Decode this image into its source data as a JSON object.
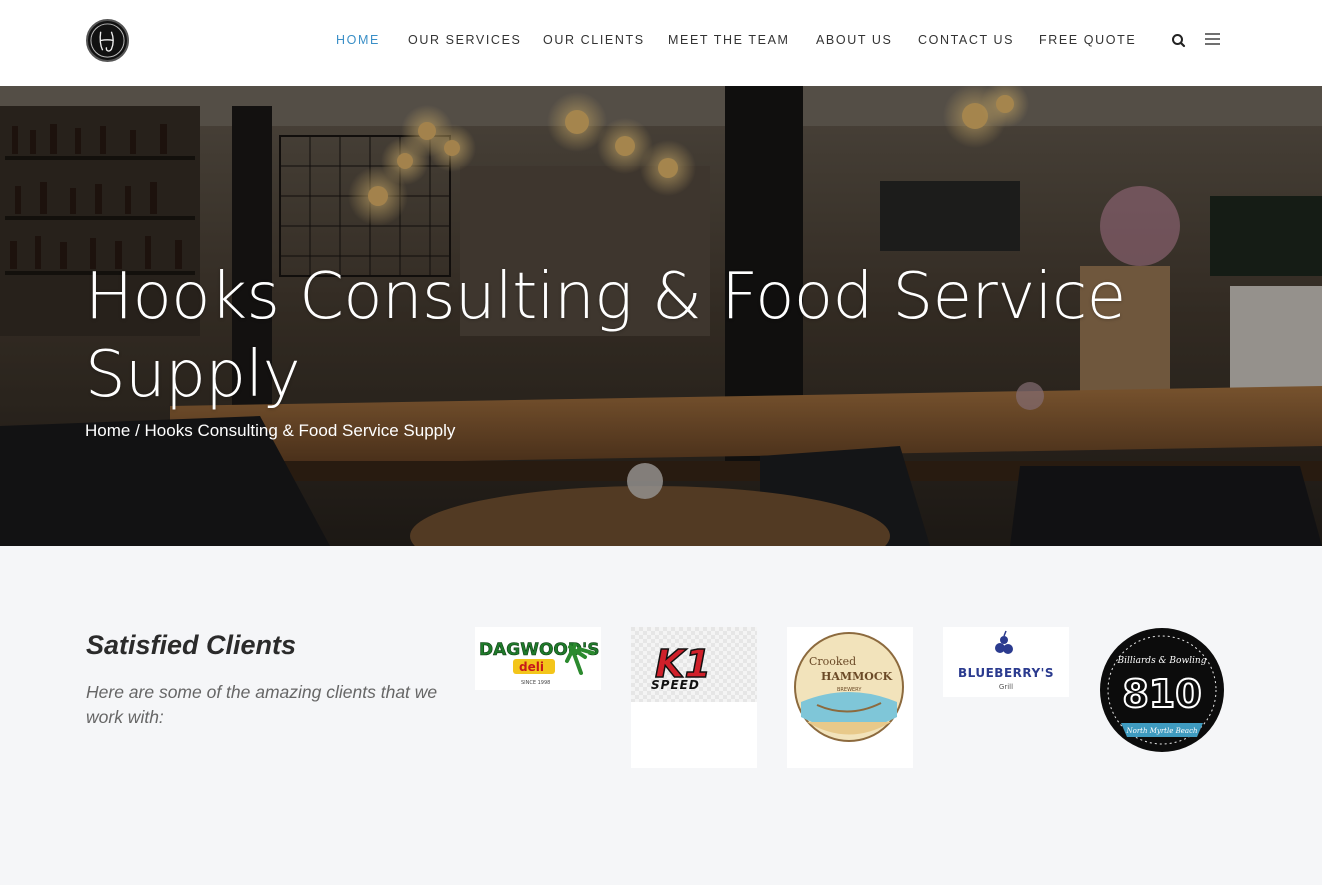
{
  "nav": {
    "items": [
      {
        "label": "HOME",
        "active": true
      },
      {
        "label": "OUR SERVICES",
        "active": false
      },
      {
        "label": "OUR CLIENTS",
        "active": false
      },
      {
        "label": "MEET THE TEAM",
        "active": false
      },
      {
        "label": "ABOUT US",
        "active": false
      },
      {
        "label": "CONTACT US",
        "active": false
      },
      {
        "label": "FREE QUOTE",
        "active": false
      }
    ],
    "search_icon": "search-icon",
    "menu_icon": "hamburger-menu-icon",
    "accent_color": "#3a8fc7"
  },
  "hero": {
    "title": "Hooks Consulting & Food Service Supply",
    "breadcrumb_home": "Home",
    "breadcrumb_sep": " / ",
    "breadcrumb_current": "Hooks Consulting & Food Service Supply"
  },
  "clients": {
    "title": "Satisfied Clients",
    "description": "Here are some of the amazing clients that we work with:",
    "logos": [
      {
        "name": "Dagwood's deli",
        "text_main": "DAGWOOD'S",
        "text_sub": "deli",
        "text_small": "SINCE 1998"
      },
      {
        "name": "K1 Speed",
        "text_main": "K1",
        "text_sub": "SPEED"
      },
      {
        "name": "Crooked Hammock Brewery",
        "text_main": "Crooked",
        "text_sub": "HAMMOCK",
        "text_small": "BREWERY"
      },
      {
        "name": "Blueberry's Grill",
        "text_main": "BLUEBERRY'S",
        "text_sub": "Grill"
      },
      {
        "name": "810 Billiards & Bowling",
        "text_main": "810",
        "text_sub": "Billiards & Bowling",
        "text_small": "North Myrtle Beach"
      }
    ]
  }
}
